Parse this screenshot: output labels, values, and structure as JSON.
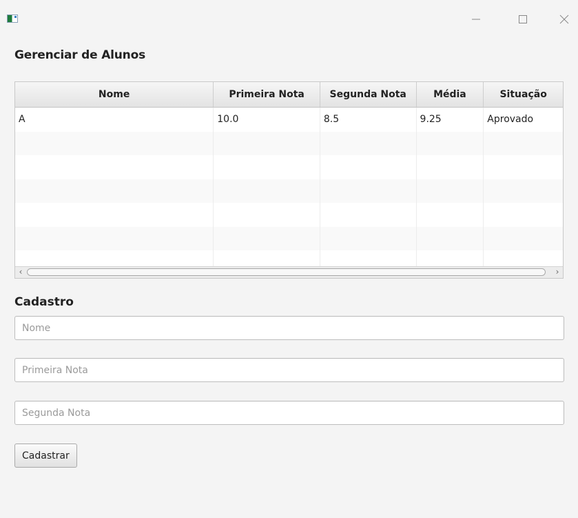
{
  "window": {
    "title": ""
  },
  "page": {
    "title": "Gerenciar de Alunos"
  },
  "table": {
    "columns": [
      "Nome",
      "Primeira Nota",
      "Segunda Nota",
      "Média",
      "Situação"
    ],
    "rows": [
      [
        "A",
        "10.0",
        "8.5",
        "9.25",
        "Aprovado"
      ]
    ]
  },
  "form": {
    "title": "Cadastro",
    "nome_placeholder": "Nome",
    "nome_value": "",
    "primeira_nota_placeholder": "Primeira Nota",
    "primeira_nota_value": "",
    "segunda_nota_placeholder": "Segunda Nota",
    "segunda_nota_value": "",
    "submit_label": "Cadastrar"
  },
  "icons": {
    "app": "app-icon",
    "minimize": "minimize-icon",
    "maximize": "maximize-icon",
    "close": "close-icon",
    "scroll_left": "chevron-left-icon",
    "scroll_right": "chevron-right-icon"
  }
}
